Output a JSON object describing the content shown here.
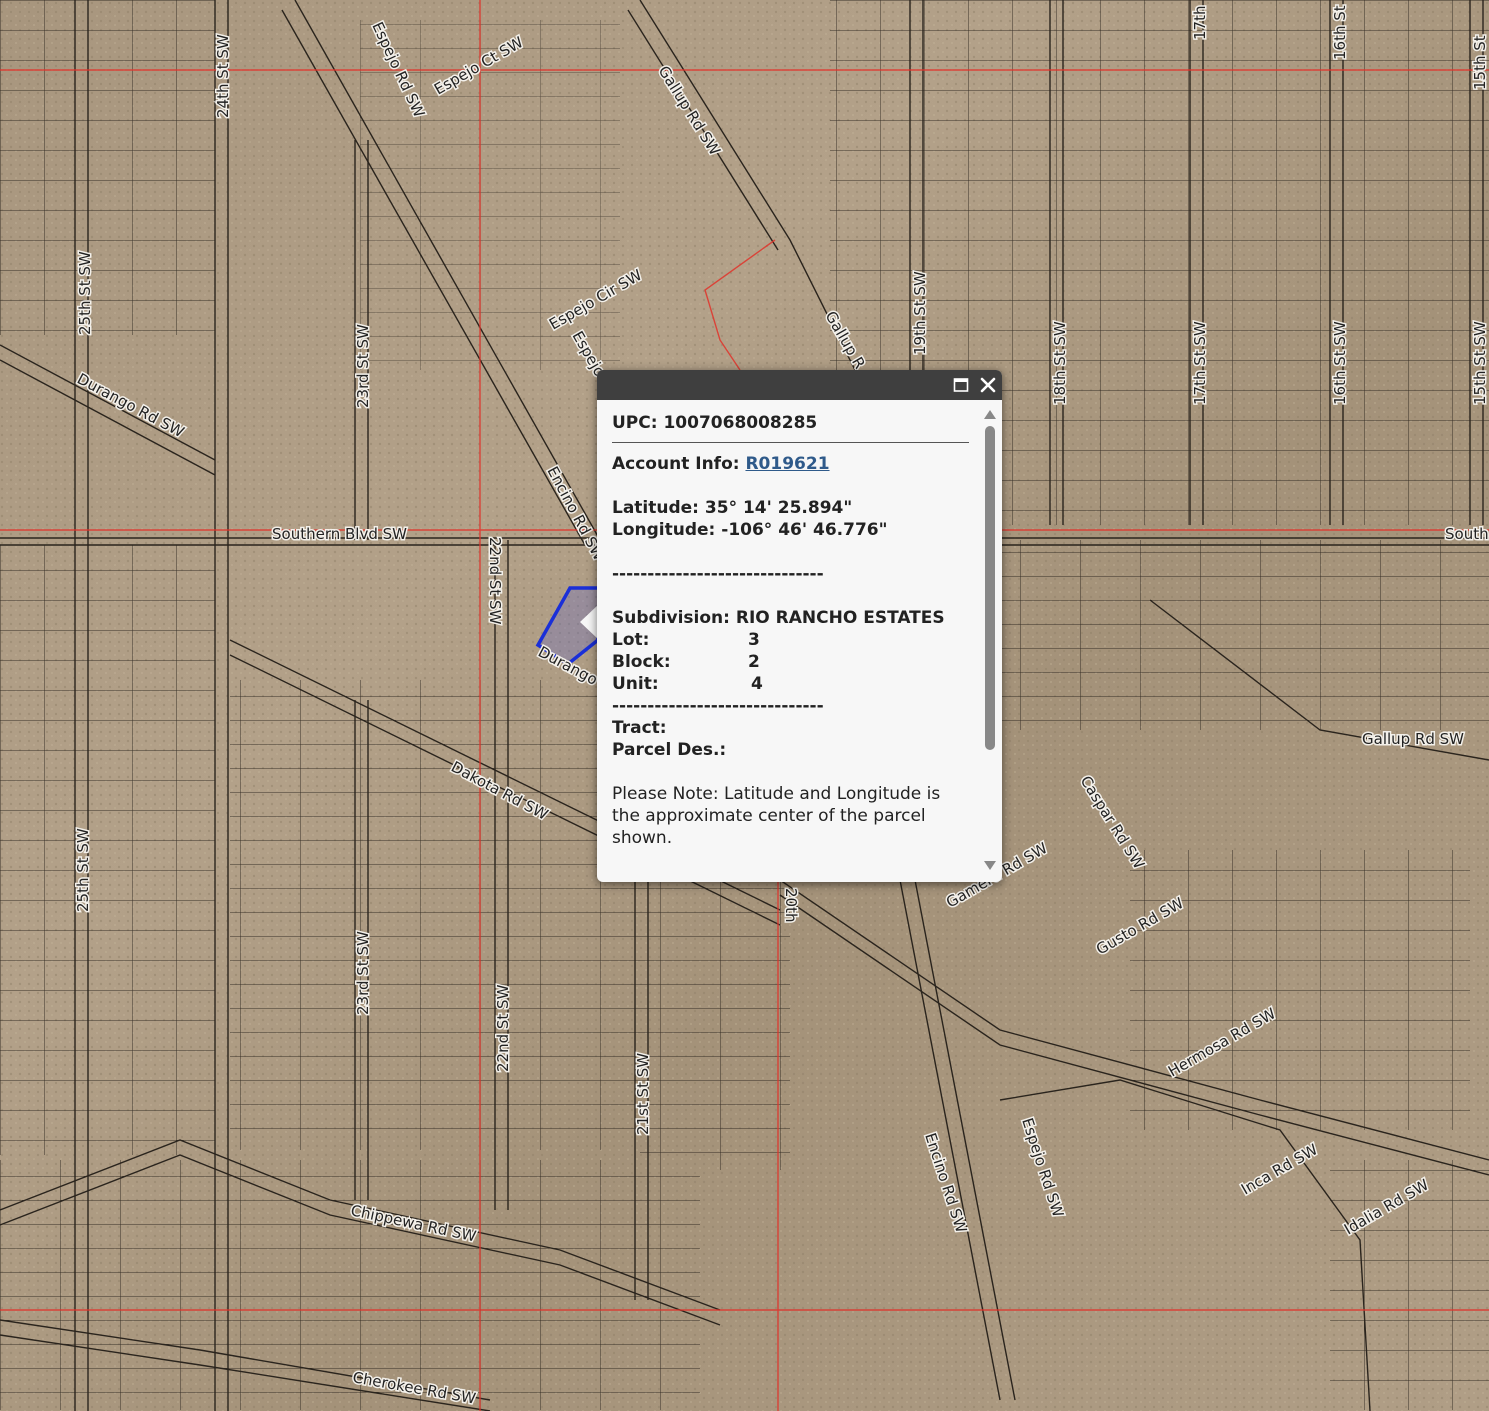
{
  "map": {
    "roads": [
      "Espejo Rd SW",
      "Espejo Ct SW",
      "Gallup Rd SW",
      "Espejo Cir SW",
      "Espejo",
      "Gallup R",
      "24th St SW",
      "25th St SW",
      "23rd St SW",
      "Durango Rd SW",
      "19th St SW",
      "18th St SW",
      "17th St SW",
      "16th St SW",
      "15th St SW",
      "17th",
      "16th St",
      "15th St",
      "Encino Rd SW",
      "Southern Blvd SW",
      "South",
      "22nd St SW",
      "Durango",
      "Dakota Rd SW",
      "Gallup Rd SW",
      "Caspar Rd SW",
      "Gamerd Rd SW",
      "Gusto Rd SW",
      "Hermosa Rd SW",
      "Inca Rd SW",
      "Idalia Rd SW",
      "Encino Rd SW",
      "Espejo Rd SW",
      "Chippewa Rd SW",
      "Cherokee Rd SW",
      "21st St SW",
      "20th",
      "22nd St SW",
      "23rd St SW",
      "25th St SW"
    ]
  },
  "popup": {
    "upc_label": "UPC:",
    "upc_value": "1007068008285",
    "account_label": "Account Info:",
    "account_value": "R019621",
    "lat_label": "Latitude:",
    "lat_value": "35° 14' 25.894\"",
    "lon_label": "Longitude:",
    "lon_value": "-106° 46' 46.776\"",
    "separator": "------------------------------",
    "subdivision_label": "Subdivision:",
    "subdivision_value": "RIO RANCHO ESTATES",
    "lot_label": "Lot:",
    "lot_value": "3",
    "block_label": "Block:",
    "block_value": "2",
    "unit_label": "Unit:",
    "unit_value": "4",
    "tract_label": "Tract:",
    "tract_value": "",
    "parcel_label": "Parcel Des.:",
    "parcel_value": "",
    "note": "Please Note: Latitude and Longitude is the approximate center of the parcel shown."
  },
  "icons": {
    "maximize": "maximize-icon",
    "close": "close-icon",
    "scroll_up": "triangle-up-icon",
    "scroll_down": "triangle-down-icon"
  },
  "colors": {
    "header": "#3f3f3f",
    "selected_parcel": "#1a2fd8",
    "section_line": "#e0322a",
    "link": "#2f5a8a"
  }
}
